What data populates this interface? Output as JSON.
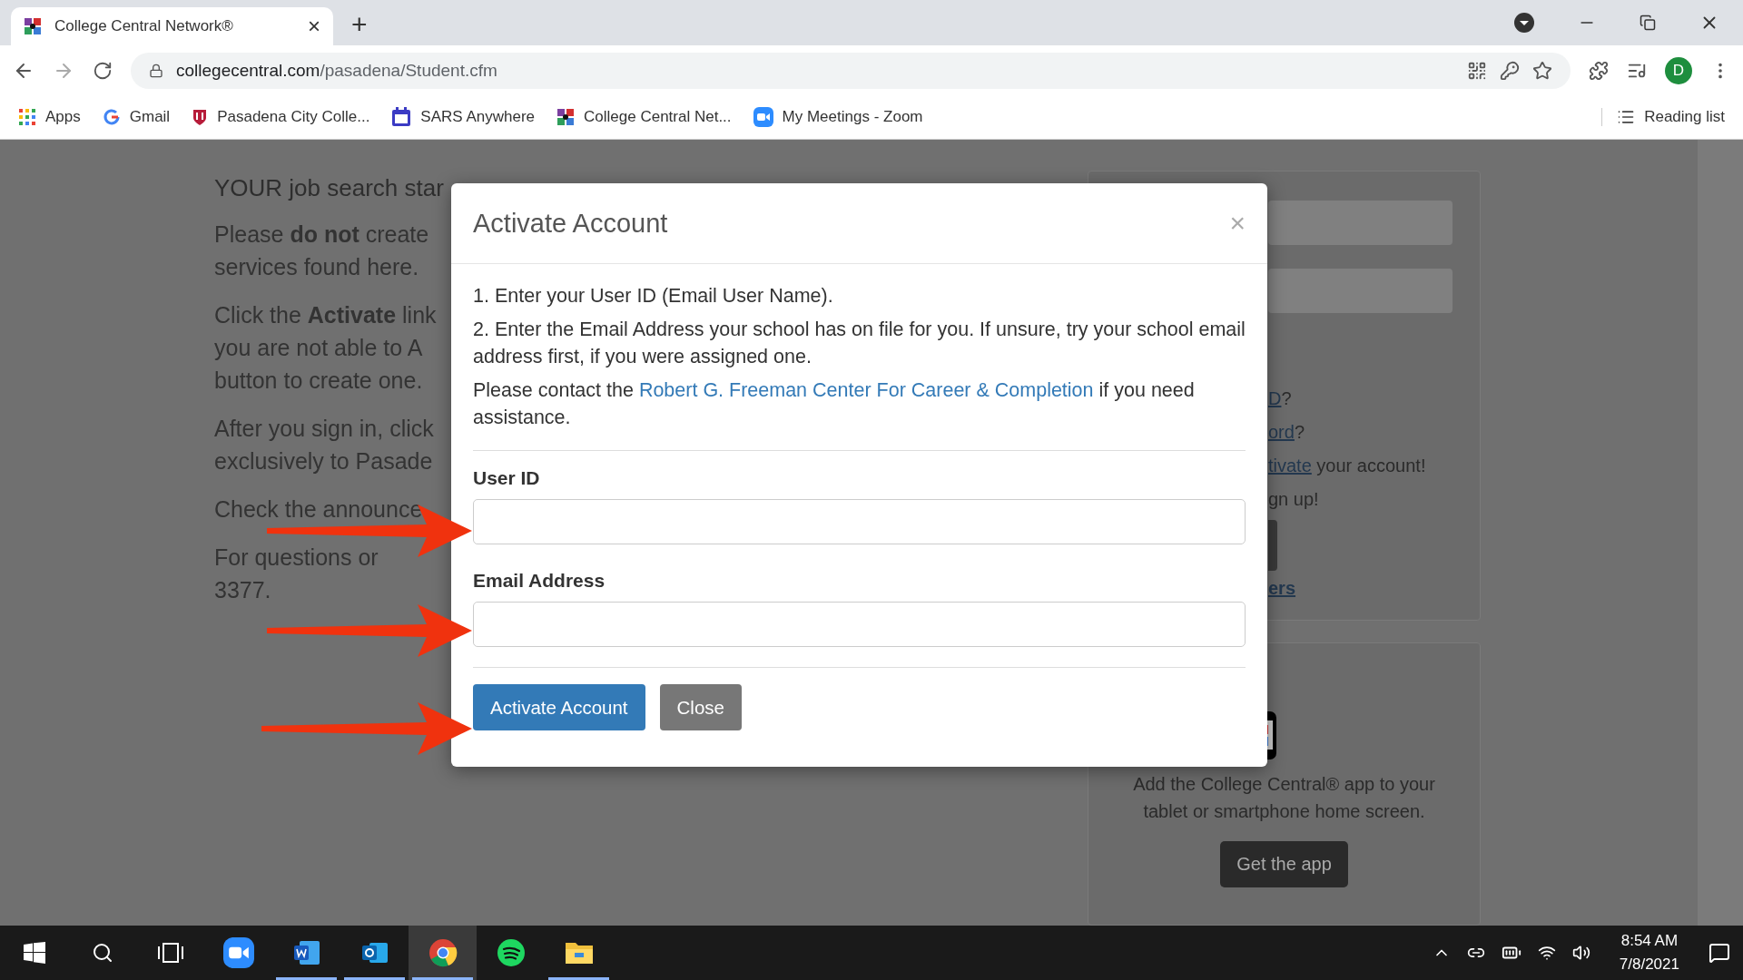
{
  "browser": {
    "tab": {
      "title": "College Central Network®",
      "close": "×"
    },
    "new_tab": "+",
    "url": {
      "domain": "collegecentral.com",
      "path": "/pasadena/Student.cfm"
    },
    "profile": "D",
    "bookmarks": [
      {
        "kind": "apps",
        "label": "Apps"
      },
      {
        "kind": "google",
        "label": "Gmail"
      },
      {
        "kind": "college",
        "label": "Pasadena City Colle..."
      },
      {
        "kind": "calendar",
        "label": "SARS Anywhere"
      },
      {
        "kind": "network",
        "label": "College Central Net..."
      },
      {
        "kind": "zoom",
        "label": "My Meetings - Zoom"
      }
    ],
    "reading_list": "Reading list"
  },
  "page": {
    "heading": "YOUR job search star",
    "paragraphs": [
      [
        "Please **do not** create",
        "services found here."
      ],
      [
        "Click the **Activate** link",
        "you are not able to A",
        "button to create one."
      ],
      [
        "After you sign in, click",
        "exclusively to Pasade"
      ],
      [
        "Check the announce"
      ],
      [
        "For questions or",
        "3377."
      ]
    ]
  },
  "login_panel": {
    "lines": [
      {
        "link": "D",
        "rest": "?"
      },
      {
        "link": "ord",
        "rest": "?"
      },
      {
        "link": "tivate",
        "rest": " your account!"
      },
      {
        "rest": "gn up!"
      }
    ],
    "bottom_link": "ers"
  },
  "app_panel": {
    "text": "Add the College Central® app to your tablet or smartphone home screen.",
    "button": "Get the app"
  },
  "modal": {
    "title": "Activate Account",
    "close": "×",
    "steps": [
      "1. Enter your User ID (Email User Name).",
      "2. Enter the Email Address your school has on file for you. If unsure, try your school email address first, if you were assigned one."
    ],
    "contact": {
      "before": "Please contact the ",
      "link": "Robert G. Freeman Center For Career & Completion",
      "after": " if you need assistance."
    },
    "fields": [
      {
        "label": "User ID"
      },
      {
        "label": "Email Address"
      }
    ],
    "buttons": [
      {
        "kind": "primary",
        "label": "Activate Account"
      },
      {
        "kind": "secondary",
        "label": "Close"
      }
    ]
  },
  "taskbar": {
    "apps": [
      {
        "kind": "zoom",
        "running": false,
        "selected": false
      },
      {
        "kind": "word",
        "running": true,
        "selected": false
      },
      {
        "kind": "outlook",
        "running": true,
        "selected": false
      },
      {
        "kind": "chrome",
        "running": true,
        "selected": true
      },
      {
        "kind": "spotify",
        "running": false,
        "selected": false
      },
      {
        "kind": "explorer",
        "running": true,
        "selected": false
      }
    ],
    "time": "8:54 AM",
    "date": "7/8/2021"
  }
}
